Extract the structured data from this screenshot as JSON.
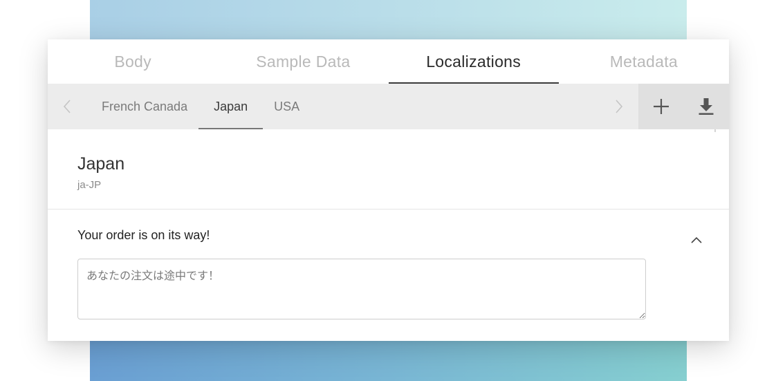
{
  "main_tabs": [
    {
      "label": "Body",
      "active": false
    },
    {
      "label": "Sample Data",
      "active": false
    },
    {
      "label": "Localizations",
      "active": true
    },
    {
      "label": "Metadata",
      "active": false
    }
  ],
  "sub_tabs": [
    {
      "label": "French Canada",
      "active": false
    },
    {
      "label": "Japan",
      "active": true
    },
    {
      "label": "USA",
      "active": false
    }
  ],
  "icons": {
    "prev": "chevron-left-icon",
    "next": "chevron-right-icon",
    "add": "plus-icon",
    "download": "download-icon",
    "collapse": "chevron-up-icon"
  },
  "locale": {
    "name": "Japan",
    "code": "ja-JP"
  },
  "entry": {
    "label": "Your order is on its way!",
    "value": "あなたの注文は途中です！"
  },
  "colors": {
    "active_text": "#2a2a2a",
    "inactive_text": "#b9b9b9",
    "subbar_bg": "#ececec",
    "actions_bg": "#e0e0e0"
  }
}
